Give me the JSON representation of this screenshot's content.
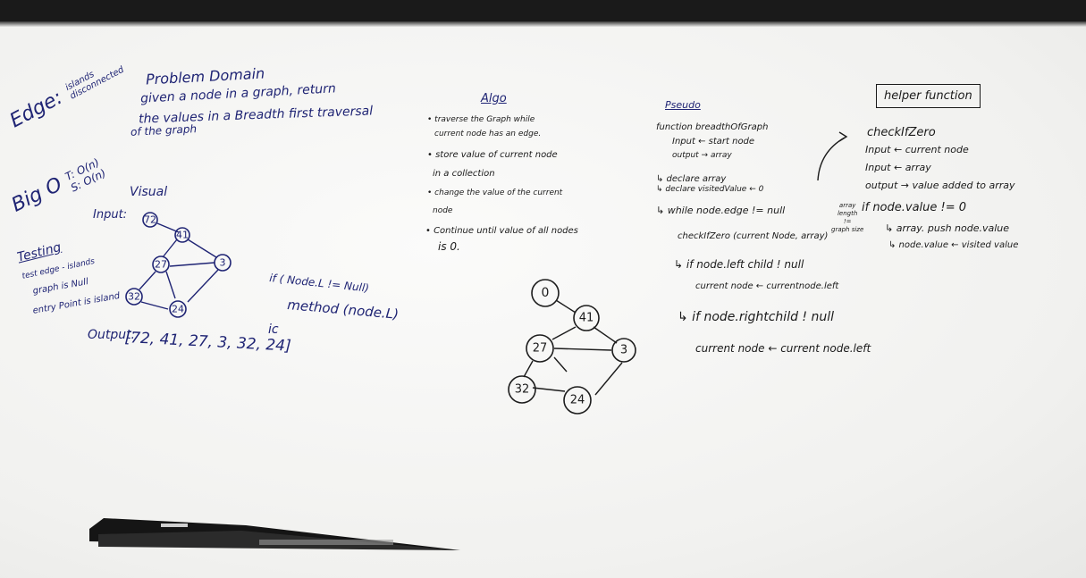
{
  "edge_note": {
    "title": "Edge:",
    "items": [
      "islands",
      "disconnected"
    ]
  },
  "big_o": {
    "label": "Big O",
    "time": "T: O(n)",
    "space": "S: O(n)"
  },
  "problem_domain": {
    "title": "Problem Domain",
    "lines": [
      "given a node in a graph, return",
      "the values in a Breadth first traversal",
      "of the graph"
    ]
  },
  "visual": {
    "title": "Visual",
    "input_label": "Input:",
    "nodes": [
      "72",
      "41",
      "27",
      "3",
      "32",
      "24"
    ],
    "output_label": "Output:",
    "output_value": "[72, 41, 27, 3, 32, 24]"
  },
  "testing": {
    "title": "Testing",
    "lines": [
      "test edge - islands",
      "graph is Null",
      "entry Point is island"
    ]
  },
  "code_snippet": {
    "line1": "if ( Node.L != Null)",
    "line2": "method (node.L)",
    "line3": "ic"
  },
  "algo": {
    "title": "Algo",
    "steps": [
      "• traverse the Graph while",
      "current node has an edge.",
      "• store value of current node",
      "in a collection",
      "• change the value of the current",
      "node",
      "• Continue until value of all nodes",
      "is 0."
    ],
    "graph_nodes": [
      "0",
      "41",
      "27",
      "3",
      "32",
      "24"
    ]
  },
  "pseudo": {
    "title": "Pseudo",
    "lines": [
      "function breadthOfGraph",
      "Input ← start node",
      "output → array",
      "↳ declare array",
      "↳ declare visitedValue ← 0",
      "↳ while node.edge != null",
      "checkIfZero (current Node, array)",
      "↳ if node.left child ! null",
      "current node ← currentnode.left",
      "↳ if node.rightchild ! null",
      "current node ← current node.left"
    ],
    "margin_note": [
      "array",
      "length",
      "!=",
      "graph size"
    ]
  },
  "helper": {
    "title": "helper function",
    "lines": [
      "checkIfZero",
      "Input ← current node",
      "Input ← array",
      "output → value added to array",
      "if node.value != 0",
      "↳ array. push node.value",
      "↳ node.value ← visited value"
    ]
  }
}
